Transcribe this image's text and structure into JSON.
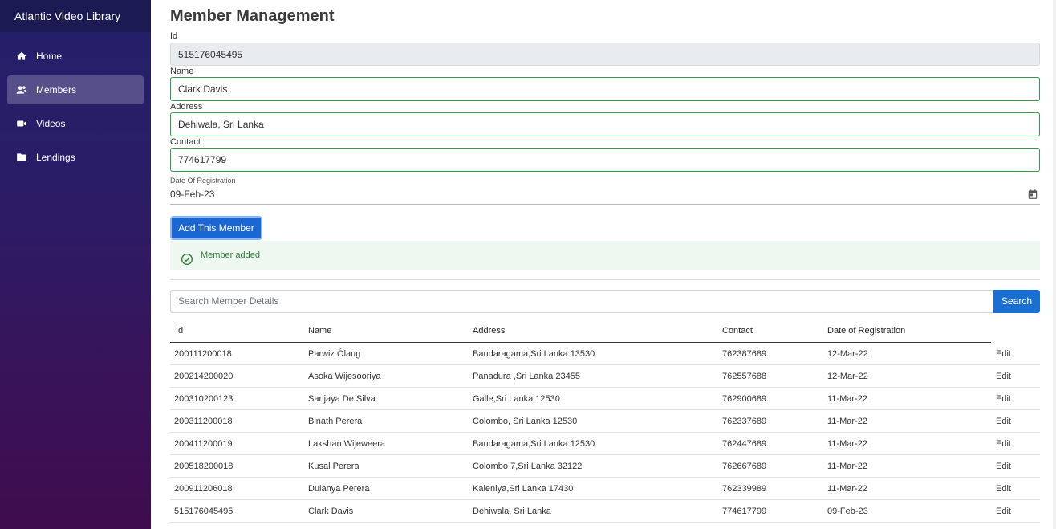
{
  "app": {
    "brand": "Atlantic Video Library"
  },
  "sidebar": {
    "items": [
      {
        "label": "Home",
        "icon": "home-icon",
        "active": false
      },
      {
        "label": "Members",
        "icon": "users-icon",
        "active": true
      },
      {
        "label": "Videos",
        "icon": "video-camera-icon",
        "active": false
      },
      {
        "label": "Lendings",
        "icon": "folder-icon",
        "active": false
      }
    ]
  },
  "form": {
    "title": "Member Management",
    "id_label": "Id",
    "id_value": "515176045495",
    "name_label": "Name",
    "name_value": "Clark Davis",
    "address_label": "Address",
    "address_value": "Dehiwala, Sri Lanka",
    "contact_label": "Contact",
    "contact_value": "774617799",
    "date_label": "Date Of Registration",
    "date_value": "09-Feb-23",
    "submit_label": "Add This Member",
    "alert_text": "Member added"
  },
  "search": {
    "placeholder": "Search Member Details",
    "button_label": "Search"
  },
  "table": {
    "columns": [
      "Id",
      "Name",
      "Address",
      "Contact",
      "Date of Registration"
    ],
    "action_label": "Edit",
    "rows": [
      [
        "200111200018",
        "Parwiz Ólaug",
        "Bandaragama,Sri Lanka 13530",
        "762387689",
        "12-Mar-22"
      ],
      [
        "200214200020",
        "Asoka Wijesooriya",
        "Panadura ,Sri Lanka 23455",
        "762557688",
        "12-Mar-22"
      ],
      [
        "200310200123",
        "Sanjaya De Silva",
        "Galle,Sri Lanka 12530",
        "762900689",
        "11-Mar-22"
      ],
      [
        "200311200018",
        "Binath Perera",
        "Colombo, Sri Lanka 12530",
        "762337689",
        "11-Mar-22"
      ],
      [
        "200411200019",
        "Lakshan Wijeweera",
        "Bandaragama,Sri Lanka 12530",
        "762447689",
        "11-Mar-22"
      ],
      [
        "200518200018",
        "Kusal Perera",
        "Colombo 7,Sri Lanka 32122",
        "762667689",
        "11-Mar-22"
      ],
      [
        "200911206018",
        "Dulanya Perera",
        "Kaleniya,Sri Lanka 17430",
        "762339989",
        "11-Mar-22"
      ],
      [
        "515176045495",
        "Clark Davis",
        "Dehiwala, Sri Lanka",
        "774617799",
        "09-Feb-23"
      ]
    ]
  },
  "colors": {
    "primary": "#1a66d2",
    "success": "#2e7d32",
    "field_border": "#2e9e4f"
  }
}
